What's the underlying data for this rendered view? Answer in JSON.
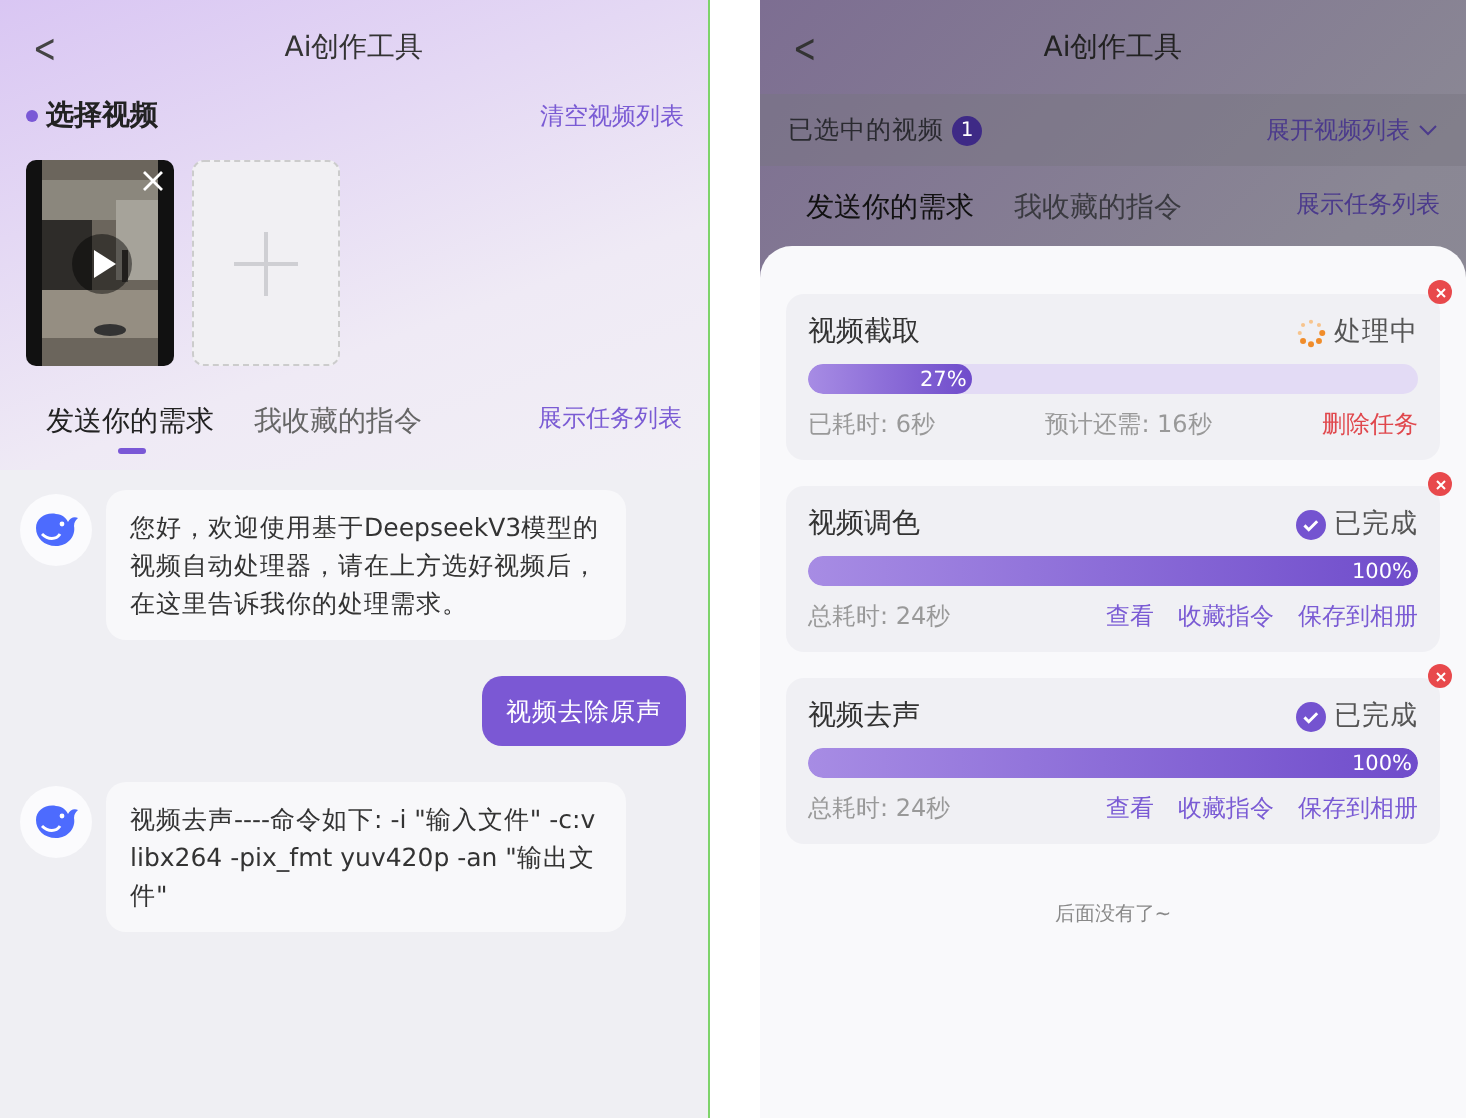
{
  "left": {
    "header": {
      "back": "<",
      "title": "Ai创作工具"
    },
    "section": {
      "title": "选择视频",
      "action": "清空视频列表"
    },
    "videos": [
      {
        "kind": "picture"
      },
      {
        "kind": "add"
      }
    ],
    "tabs": [
      {
        "label": "发送你的需求",
        "selected": true
      },
      {
        "label": "我收藏的指令",
        "selected": false
      }
    ],
    "task_link": "展示任务列表",
    "messages": [
      {
        "kind": "bot",
        "text": "您好，欢迎使用基于DeepseekV3模型的视频自动处理器，请在上方选好视频后，在这里告诉我你的处理需求。"
      },
      {
        "kind": "user",
        "text": "视频去除原声"
      },
      {
        "kind": "bot",
        "text": "视频去声----命令如下: -i \"输入文件\" -c:v libx264 -pix_fmt yuv420p -an \"输出文件\""
      }
    ]
  },
  "right": {
    "header": {
      "back": "<",
      "title": "Ai创作工具"
    },
    "selected_bar": {
      "label": "已选中的视频",
      "count": "1",
      "expand": "展开视频列表"
    },
    "tabs": [
      {
        "label": "发送你的需求",
        "selected": true
      },
      {
        "label": "我收藏的指令",
        "selected": false
      }
    ],
    "task_link": "展示任务列表",
    "tasks": [
      {
        "name": "视频截取",
        "kind": "processing",
        "status_label": "处理中",
        "level": 0.27,
        "percent": "27%",
        "elapsed": "已耗时: 6秒",
        "remaining": "预计还需: 16秒",
        "actions": [
          {
            "label": "删除任务",
            "kind": "danger"
          }
        ]
      },
      {
        "name": "视频调色",
        "kind": "done",
        "status_label": "已完成",
        "level": 1,
        "percent": "100%",
        "elapsed": "总耗时: 24秒",
        "actions": [
          {
            "label": "查看",
            "kind": "normal"
          },
          {
            "label": "收藏指令",
            "kind": "normal"
          },
          {
            "label": "保存到相册",
            "kind": "normal"
          }
        ]
      },
      {
        "name": "视频去声",
        "kind": "done",
        "status_label": "已完成",
        "level": 1,
        "percent": "100%",
        "elapsed": "总耗时: 24秒",
        "actions": [
          {
            "label": "查看",
            "kind": "normal"
          },
          {
            "label": "收藏指令",
            "kind": "normal"
          },
          {
            "label": "保存到相册",
            "kind": "normal"
          }
        ]
      }
    ],
    "footer": "后面没有了~"
  }
}
